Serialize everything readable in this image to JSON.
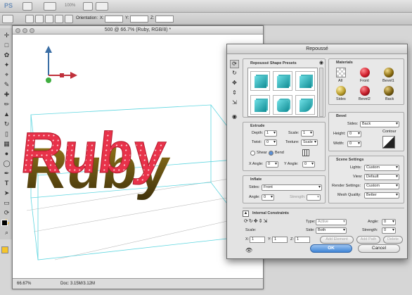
{
  "appbar": {
    "zoom_label": "100%",
    "logo": "PS"
  },
  "optionsbar": {
    "orientation_label": "Orientation:",
    "x_label": "X:",
    "y_label": "Y:",
    "z_label": "Z:"
  },
  "document": {
    "title": "500 @ 66.7% (Ruby, RGB/8) *",
    "zoom": "66.67%",
    "doc_info": "Doc: 3.15M/3.12M",
    "artwork_text": "Ruby"
  },
  "dialog": {
    "title": "Repoussé",
    "presets": {
      "title": "Repoussé Shape Presets"
    },
    "extrude": {
      "title": "Extrude",
      "depth_label": "Depth:",
      "depth_value": "1",
      "scale_label": "Scale:",
      "scale_value": "1",
      "twist_label": "Twist:",
      "twist_value": "0",
      "texture_label": "Texture:",
      "texture_value": "Scale",
      "shear_label": "Shear",
      "bend_label": "Bend",
      "xangle_label": "X Angle:",
      "xangle_value": "0",
      "yangle_label": "Y Angle:",
      "yangle_value": "0"
    },
    "inflate": {
      "title": "Inflate",
      "sides_label": "Sides:",
      "sides_value": "Front",
      "angle_label": "Angle:",
      "angle_value": "0",
      "strength_label": "Strength:"
    },
    "materials": {
      "title": "Materials",
      "items": [
        {
          "label": "All",
          "color": "#ffffff"
        },
        {
          "label": "Front",
          "color": "#d01d2b"
        },
        {
          "label": "Bevel1",
          "color": "#8a6b10"
        },
        {
          "label": "Sides",
          "color": "#b99c2a"
        },
        {
          "label": "Bevel2",
          "color": "#c01a27"
        },
        {
          "label": "Back",
          "color": "#7a6012"
        }
      ]
    },
    "bevel": {
      "title": "Bevel",
      "sides_label": "Sides:",
      "sides_value": "Back",
      "height_label": "Height:",
      "height_value": "0",
      "width_label": "Width:",
      "width_value": "0",
      "contour_label": "Contour"
    },
    "scene": {
      "title": "Scene Settings",
      "lights_label": "Lights:",
      "lights_value": "Custom",
      "view_label": "View:",
      "view_value": "Default",
      "render_label": "Render Settings:",
      "render_value": "Custom",
      "mesh_label": "Mesh Quality:",
      "mesh_value": "Better"
    },
    "constraints": {
      "title": "Internal Constraints",
      "type_label": "Type:",
      "type_value": "Active",
      "angle_label": "Angle:",
      "angle_value": "0",
      "side_label": "Side:",
      "side_value": "Both",
      "strength_label": "Strength:",
      "strength_value": "0",
      "scale_label": "Scale:",
      "x_label": "X:",
      "x_value": "1",
      "y_label": "Y:",
      "y_value": "1",
      "z_label": "Z:",
      "z_value": "1",
      "add_element": "Add Element",
      "add_path": "Add Path",
      "delete": "Delete"
    },
    "ok_label": "OK",
    "cancel_label": "Cancel"
  }
}
